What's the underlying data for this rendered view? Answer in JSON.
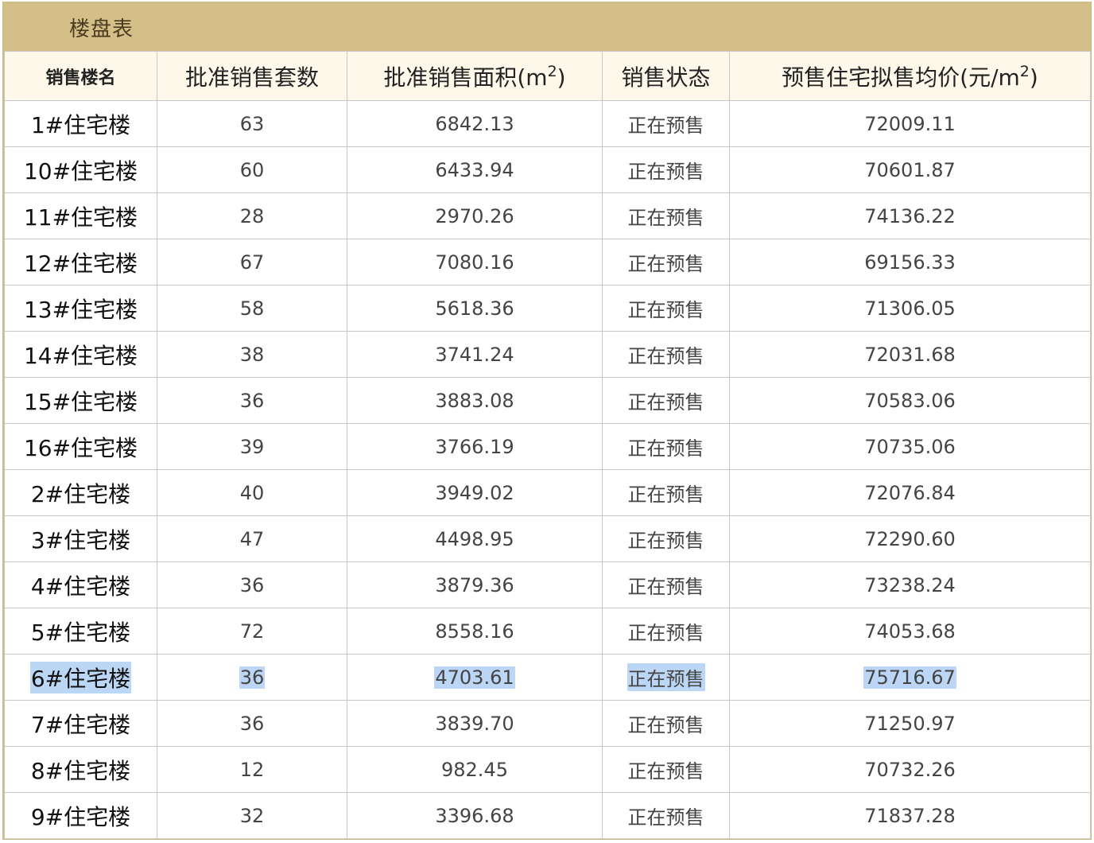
{
  "table_title": "楼盘表",
  "headers": {
    "name": "销售楼名",
    "units": "批准销售套数",
    "area_prefix": "批准销售面积(m",
    "area_sup": "2",
    "area_suffix": ")",
    "status": "销售状态",
    "price_prefix": "预售住宅拟售均价(元/m",
    "price_sup": "2",
    "price_suffix": ")"
  },
  "rows": [
    {
      "name": "1#住宅楼",
      "units": "63",
      "area": "6842.13",
      "status": "正在预售",
      "price": "72009.11"
    },
    {
      "name": "10#住宅楼",
      "units": "60",
      "area": "6433.94",
      "status": "正在预售",
      "price": "70601.87"
    },
    {
      "name": "11#住宅楼",
      "units": "28",
      "area": "2970.26",
      "status": "正在预售",
      "price": "74136.22"
    },
    {
      "name": "12#住宅楼",
      "units": "67",
      "area": "7080.16",
      "status": "正在预售",
      "price": "69156.33"
    },
    {
      "name": "13#住宅楼",
      "units": "58",
      "area": "5618.36",
      "status": "正在预售",
      "price": "71306.05"
    },
    {
      "name": "14#住宅楼",
      "units": "38",
      "area": "3741.24",
      "status": "正在预售",
      "price": "72031.68"
    },
    {
      "name": "15#住宅楼",
      "units": "36",
      "area": "3883.08",
      "status": "正在预售",
      "price": "70583.06"
    },
    {
      "name": "16#住宅楼",
      "units": "39",
      "area": "3766.19",
      "status": "正在预售",
      "price": "70735.06"
    },
    {
      "name": "2#住宅楼",
      "units": "40",
      "area": "3949.02",
      "status": "正在预售",
      "price": "72076.84"
    },
    {
      "name": "3#住宅楼",
      "units": "47",
      "area": "4498.95",
      "status": "正在预售",
      "price": "72290.60"
    },
    {
      "name": "4#住宅楼",
      "units": "36",
      "area": "3879.36",
      "status": "正在预售",
      "price": "73238.24"
    },
    {
      "name": "5#住宅楼",
      "units": "72",
      "area": "8558.16",
      "status": "正在预售",
      "price": "74053.68"
    },
    {
      "name": "6#住宅楼",
      "units": "36",
      "area": "4703.61",
      "status": "正在预售",
      "price": "75716.67"
    },
    {
      "name": "7#住宅楼",
      "units": "36",
      "area": "3839.70",
      "status": "正在预售",
      "price": "71250.97"
    },
    {
      "name": "8#住宅楼",
      "units": "12",
      "area": "982.45",
      "status": "正在预售",
      "price": "70732.26"
    },
    {
      "name": "9#住宅楼",
      "units": "32",
      "area": "3396.68",
      "status": "正在预售",
      "price": "71837.28"
    }
  ],
  "selection": {
    "selected_row_index": 12,
    "color": "#bcd6f5"
  },
  "colors": {
    "title_bar": "#d4bf88",
    "header_bg": "#fdf8e9",
    "border": "#c8c8c8"
  }
}
